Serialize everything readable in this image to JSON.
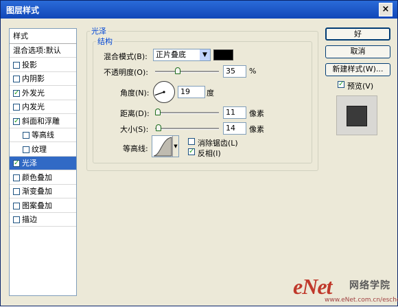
{
  "window": {
    "title": "图层样式",
    "close_label": "×"
  },
  "left_panel": {
    "header": "样式",
    "items": [
      {
        "label": "混合选项:默认",
        "checkbox": false,
        "checked": false,
        "indent": 0,
        "selected": false
      },
      {
        "label": "投影",
        "checkbox": true,
        "checked": false,
        "indent": 0,
        "selected": false
      },
      {
        "label": "内阴影",
        "checkbox": true,
        "checked": false,
        "indent": 0,
        "selected": false
      },
      {
        "label": "外发光",
        "checkbox": true,
        "checked": true,
        "indent": 0,
        "selected": false
      },
      {
        "label": "内发光",
        "checkbox": true,
        "checked": false,
        "indent": 0,
        "selected": false
      },
      {
        "label": "斜面和浮雕",
        "checkbox": true,
        "checked": true,
        "indent": 0,
        "selected": false
      },
      {
        "label": "等高线",
        "checkbox": true,
        "checked": false,
        "indent": 1,
        "selected": false
      },
      {
        "label": "纹理",
        "checkbox": true,
        "checked": false,
        "indent": 1,
        "selected": false
      },
      {
        "label": "光泽",
        "checkbox": true,
        "checked": true,
        "indent": 0,
        "selected": true
      },
      {
        "label": "颜色叠加",
        "checkbox": true,
        "checked": false,
        "indent": 0,
        "selected": false
      },
      {
        "label": "渐变叠加",
        "checkbox": true,
        "checked": false,
        "indent": 0,
        "selected": false
      },
      {
        "label": "图案叠加",
        "checkbox": true,
        "checked": false,
        "indent": 0,
        "selected": false
      },
      {
        "label": "描边",
        "checkbox": true,
        "checked": false,
        "indent": 0,
        "selected": false
      }
    ]
  },
  "satin": {
    "group_title": "光泽",
    "structure_title": "结构",
    "blend_mode_label": "混合模式(B):",
    "blend_mode_value": "正片叠底",
    "blend_color": "#000000",
    "opacity_label": "不透明度(O):",
    "opacity_value": "35",
    "opacity_unit": "%",
    "angle_label": "角度(N):",
    "angle_value": "19",
    "angle_unit": "度",
    "distance_label": "距离(D):",
    "distance_value": "11",
    "distance_unit": "像素",
    "size_label": "大小(S):",
    "size_value": "14",
    "size_unit": "像素",
    "contour_label": "等高线:",
    "antialias_label": "消除锯齿(L)",
    "antialias_checked": false,
    "invert_label": "反相(I)",
    "invert_checked": true
  },
  "buttons": {
    "ok": "好",
    "cancel": "取消",
    "new_style": "新建样式(W)..."
  },
  "preview": {
    "label": "预览(V)",
    "checked": true
  },
  "watermark": {
    "logo": "eNet",
    "cn_text": "网络学院",
    "url": "www.eNet.com.cn/eschool"
  }
}
